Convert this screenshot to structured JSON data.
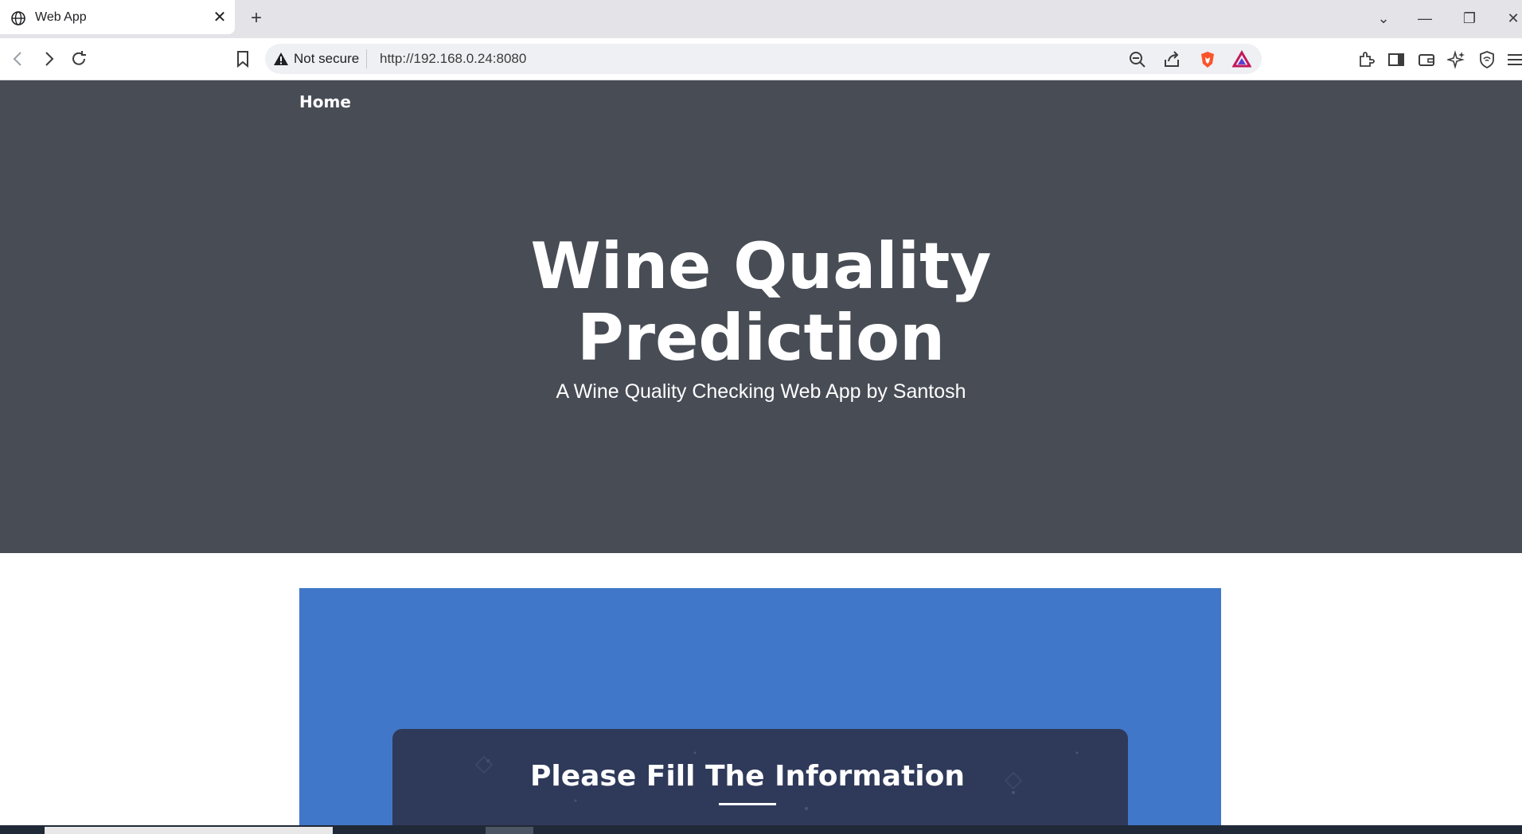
{
  "browser": {
    "tab": {
      "title": "Web App"
    },
    "security_label": "Not secure",
    "url": "http://192.168.0.24:8080"
  },
  "nav": {
    "home": "Home"
  },
  "hero": {
    "title": "Wine Quality Prediction",
    "subtitle": "A Wine Quality Checking Web App by Santosh"
  },
  "form_card": {
    "title": "Please Fill The Information"
  },
  "colors": {
    "hero_bg": "#484c55",
    "section_bg": "#4177c9",
    "card_bg": "#2f3a5a"
  }
}
